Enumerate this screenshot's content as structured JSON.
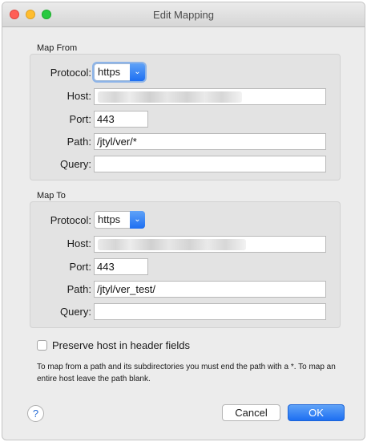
{
  "window": {
    "title": "Edit Mapping"
  },
  "map_from": {
    "section_label": "Map From",
    "protocol_label": "Protocol:",
    "protocol_value": "https",
    "host_label": "Host:",
    "host_value": "",
    "port_label": "Port:",
    "port_value": "443",
    "path_label": "Path:",
    "path_value": "/jtyl/ver/*",
    "query_label": "Query:",
    "query_value": ""
  },
  "map_to": {
    "section_label": "Map To",
    "protocol_label": "Protocol:",
    "protocol_value": "https",
    "host_label": "Host:",
    "host_value": "",
    "port_label": "Port:",
    "port_value": "443",
    "path_label": "Path:",
    "path_value": "/jtyl/ver_test/",
    "query_label": "Query:",
    "query_value": ""
  },
  "preserve_host": {
    "label": "Preserve host in header fields",
    "checked": false
  },
  "hint_text": "To map from a path and its subdirectories you must end the path with a *. To map an entire host leave the path blank.",
  "buttons": {
    "help": "?",
    "cancel": "Cancel",
    "ok": "OK"
  },
  "icons": {
    "protocol_dropdown": "chevron-updown-icon"
  }
}
